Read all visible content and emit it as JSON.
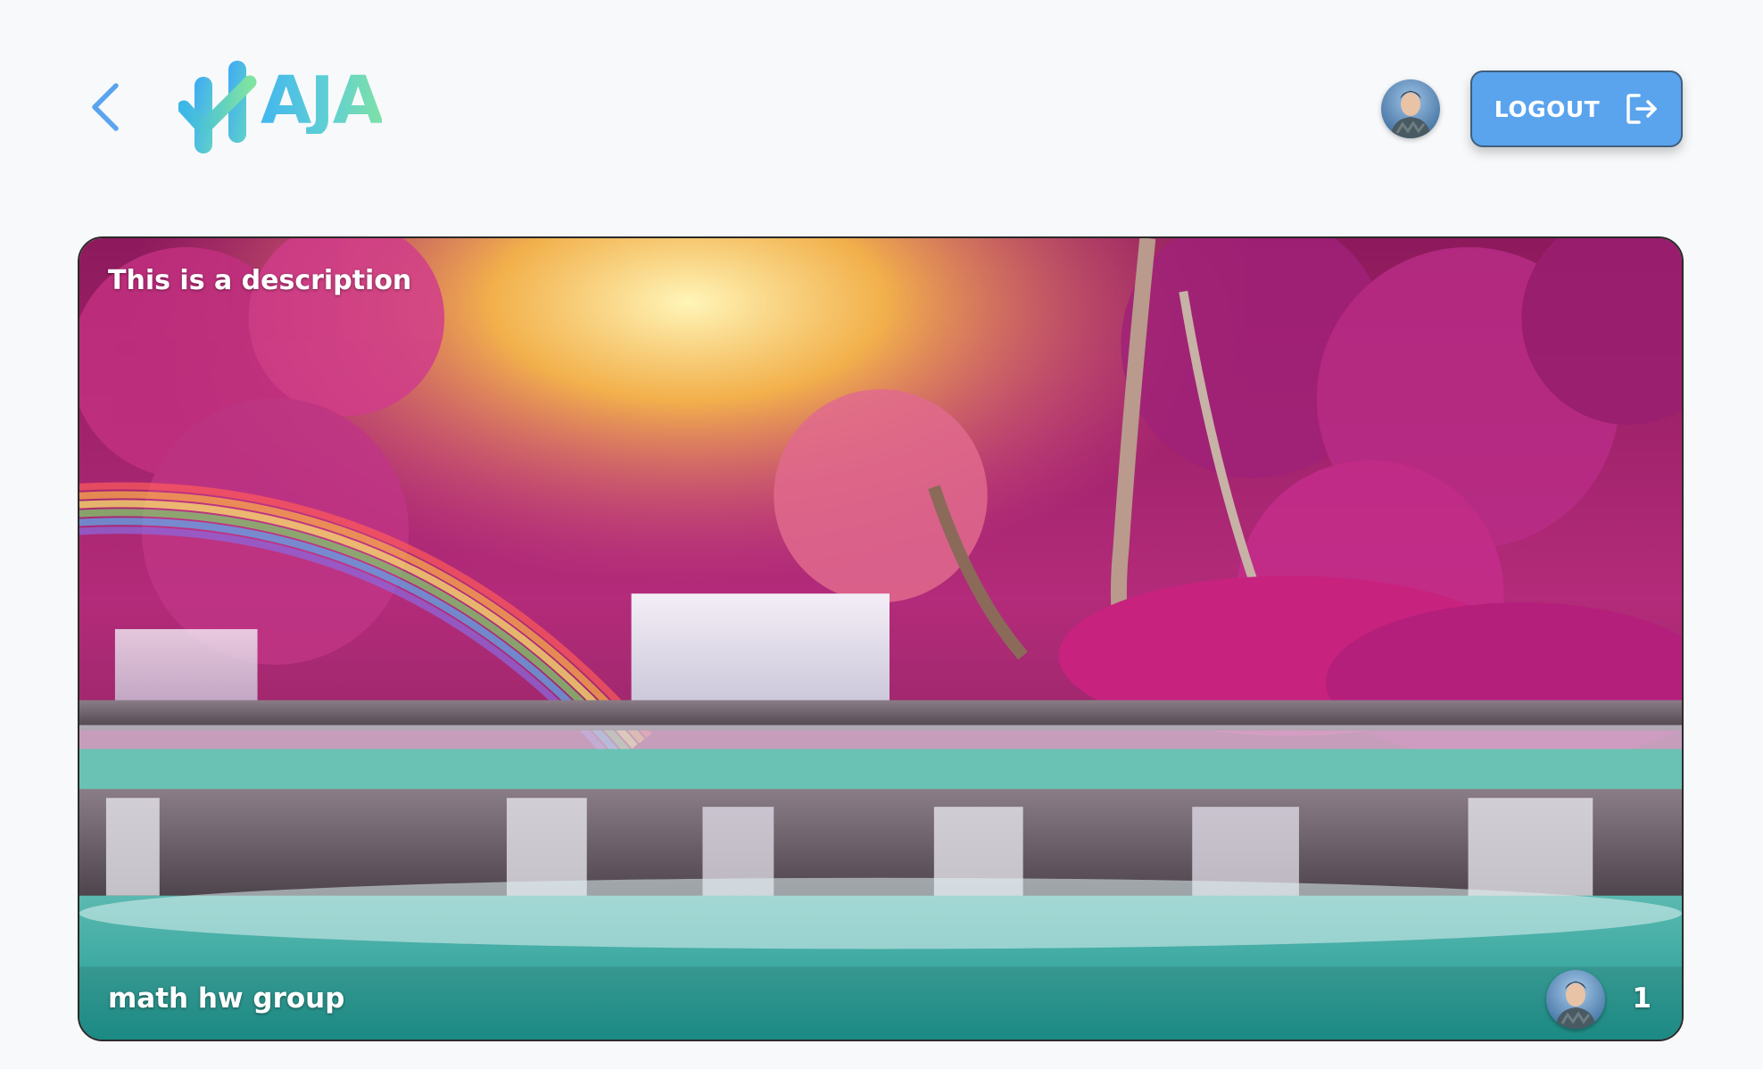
{
  "header": {
    "back_icon": "chevron-left-icon",
    "logo_text": "AJA",
    "logo_icon": "check-logo-icon",
    "avatar_icon": "user-avatar",
    "logout_label": "LOGOUT",
    "logout_icon": "logout-icon",
    "colors": {
      "accent": "#5aa4ee",
      "logo_gradient_start": "#43b6ef",
      "logo_gradient_end": "#7ee0a7",
      "background": "#f8f9fb"
    }
  },
  "group_card": {
    "description": "This is a description",
    "title": "math hw group",
    "member_count": "1",
    "image_subject": "waterfall-rainbow-pink-forest"
  }
}
